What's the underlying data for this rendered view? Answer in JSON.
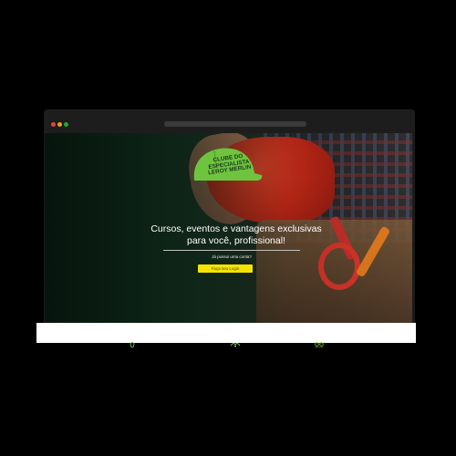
{
  "hero": {
    "logo_lines": [
      "CLUBE DO",
      "ESPECIALISTA",
      "LEROY MERLIN"
    ],
    "headline_line1": "Cursos, eventos e vantagens exclusivas",
    "headline_line2": "para você, profissional!",
    "account_prompt": "Já possui uma conta?",
    "login_label": "Faça seu Login"
  },
  "colors": {
    "brand_green": "#6ec43f",
    "login_button": "#f5e400",
    "feature_icon": "#8dc63f"
  },
  "features": [
    {
      "icon": "lightbulb-icon"
    },
    {
      "icon": "handshake-icon"
    },
    {
      "icon": "people-icon"
    }
  ]
}
